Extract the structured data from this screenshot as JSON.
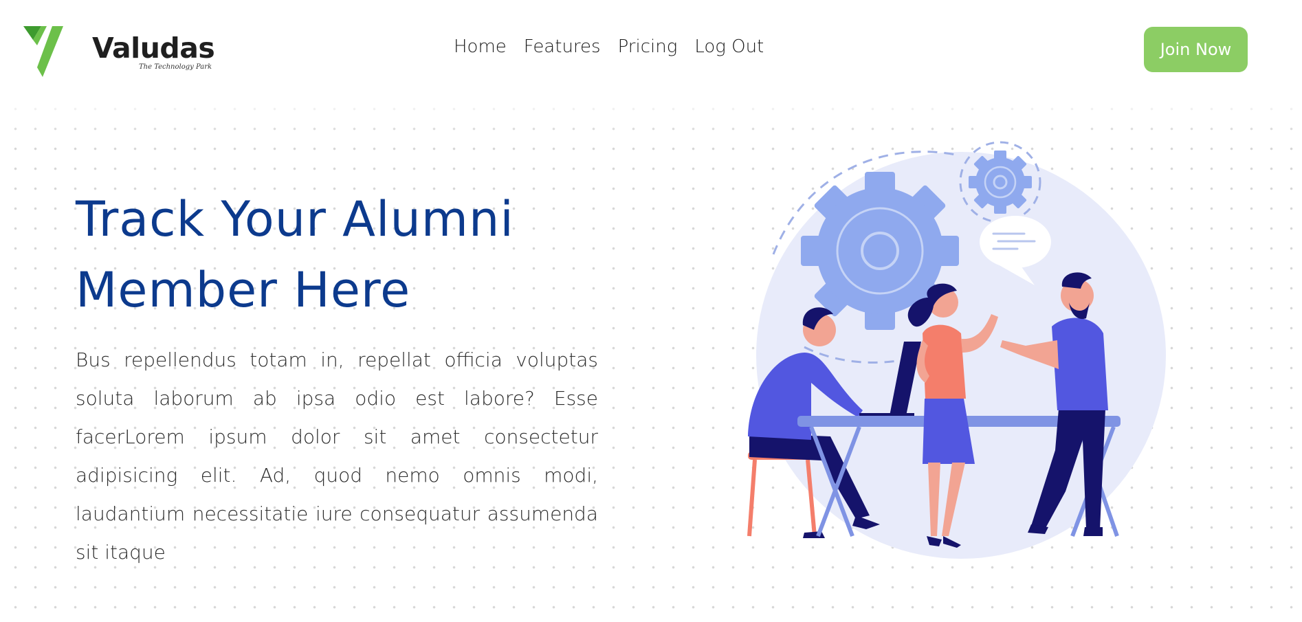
{
  "brand": {
    "name": "Valudas",
    "tagline": "The Technology Park",
    "green": "#6cc04a",
    "dark_green": "#3e9b2f"
  },
  "nav": {
    "items": [
      {
        "label": "Home"
      },
      {
        "label": "Features"
      },
      {
        "label": "Pricing"
      },
      {
        "label": "Log Out"
      }
    ]
  },
  "header": {
    "cta_label": "Join Now",
    "cta_color": "#8ccd64"
  },
  "hero": {
    "title_line1": "Track Your Alumni",
    "title_line2": "Member Here",
    "body": "Bus repellendus totam in, repellat officia voluptas soluta laborum ab ipsa odio est labore? Esse facerLorem ipsum dolor sit amet consectetur adipisicing elit. Ad, quod nemo omnis modi, laudantium necessitatie iure consequatur assumenda sit itaque",
    "title_color": "#0c3a8d"
  },
  "illustration": {
    "icon": "team-meeting-illustration",
    "colors": {
      "backdrop": "#e8ebfa",
      "gear": "#8fa9ee",
      "shirt": "#5257e0",
      "pants": "#15136b",
      "skin": "#f2a493",
      "top": "#f47e6b",
      "table": "#7f93e4"
    }
  }
}
